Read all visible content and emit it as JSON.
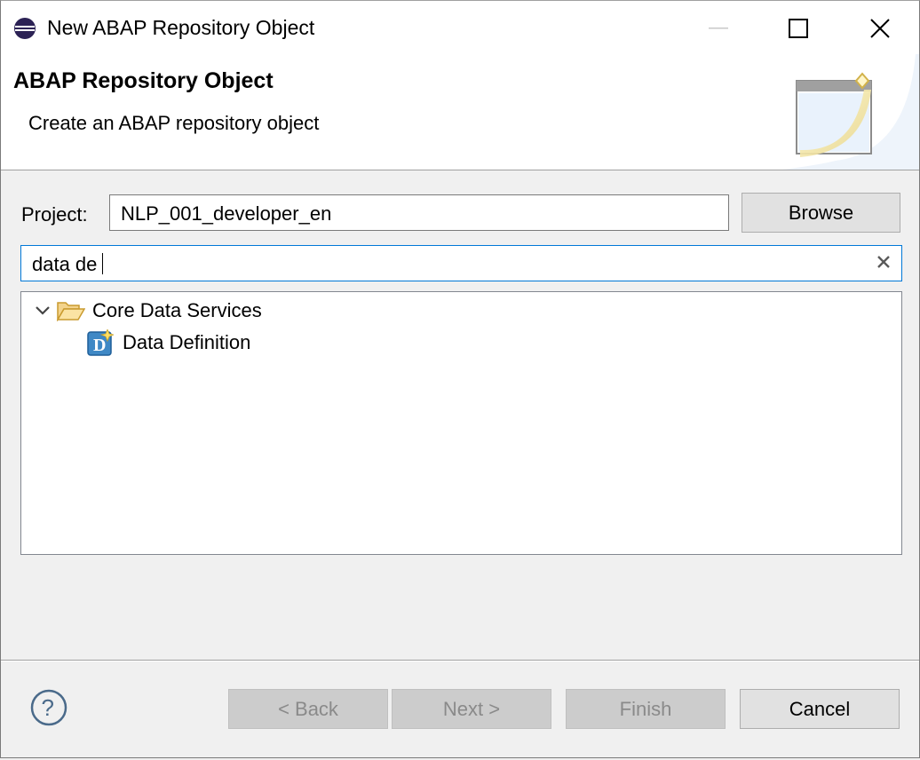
{
  "window": {
    "title": "New ABAP Repository Object",
    "icon": "eclipse-icon",
    "controls": [
      "minimize-icon",
      "maximize-icon",
      "close-icon"
    ]
  },
  "banner": {
    "title": "ABAP Repository Object",
    "subtitle": "Create an ABAP repository object",
    "graphic": "new-wizard-banner-icon"
  },
  "project": {
    "label": "Project:",
    "value": "NLP_001_developer_en",
    "browse_label": "Browse"
  },
  "filter": {
    "value": "data de",
    "clear_icon": "clear-icon"
  },
  "tree": {
    "items": [
      {
        "label": "Core Data Services",
        "icon": "folder-open-icon",
        "expanded": true
      },
      {
        "label": "Data Definition",
        "icon": "data-definition-icon"
      }
    ]
  },
  "footer": {
    "help_icon": "help-icon",
    "back_label": "< Back",
    "next_label": "Next >",
    "finish_label": "Finish",
    "cancel_label": "Cancel"
  },
  "colors": {
    "focus_border": "#0078d7",
    "dialog_bg": "#f0f0f0",
    "disabled_text": "#8a8a8a"
  }
}
